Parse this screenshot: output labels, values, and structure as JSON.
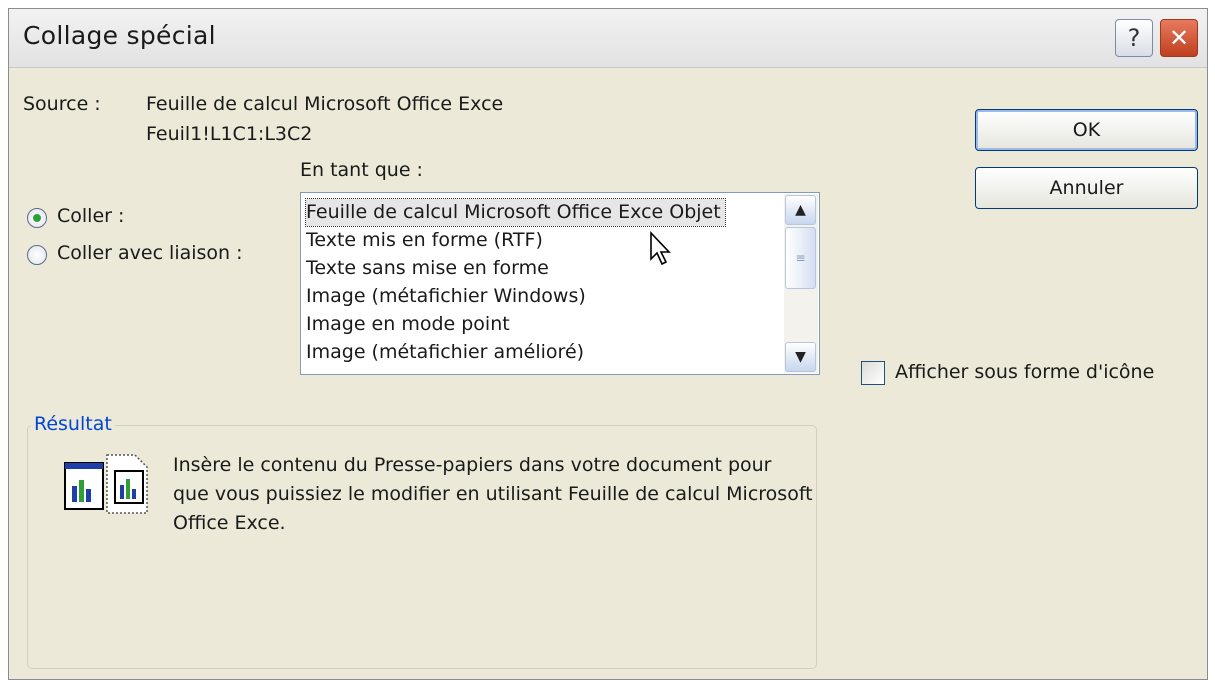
{
  "dialog": {
    "title": "Collage spécial",
    "help_label": "?",
    "close_label": "✕"
  },
  "source": {
    "label": "Source :",
    "value_line1": "Feuille de calcul Microsoft Office Exce",
    "value_line2": "Feuil1!L1C1:L3C2"
  },
  "as_label": "En tant que :",
  "paste_options": [
    {
      "label": "Coller :",
      "selected": true
    },
    {
      "label": "Coller avec liaison :",
      "selected": false
    }
  ],
  "list": {
    "items": [
      "Feuille de calcul Microsoft Office Exce Objet",
      "Texte mis en forme (RTF)",
      "Texte sans mise en forme",
      "Image (métafichier Windows)",
      "Image en mode point",
      "Image (métafichier amélioré)"
    ],
    "selected_index": 0,
    "scroll_up_icon": "chevron-up-icon",
    "scroll_down_icon": "chevron-down-icon"
  },
  "buttons": {
    "ok_label": "OK",
    "cancel_label": "Annuler"
  },
  "display_as_icon": {
    "label": "Afficher sous forme d'icône",
    "checked": false
  },
  "result": {
    "title": "Résultat",
    "text": "Insère le contenu du Presse-papiers dans votre document pour que vous puissiez le modifier en utilisant Feuille de calcul Microsoft Office Exce.",
    "icon": "embedded-object-icon"
  },
  "colors": {
    "dialog_bg": "#ece9d8",
    "accent": "#0046d5",
    "radio_selected": "#2ea03a",
    "close_red": "#c0401f"
  }
}
